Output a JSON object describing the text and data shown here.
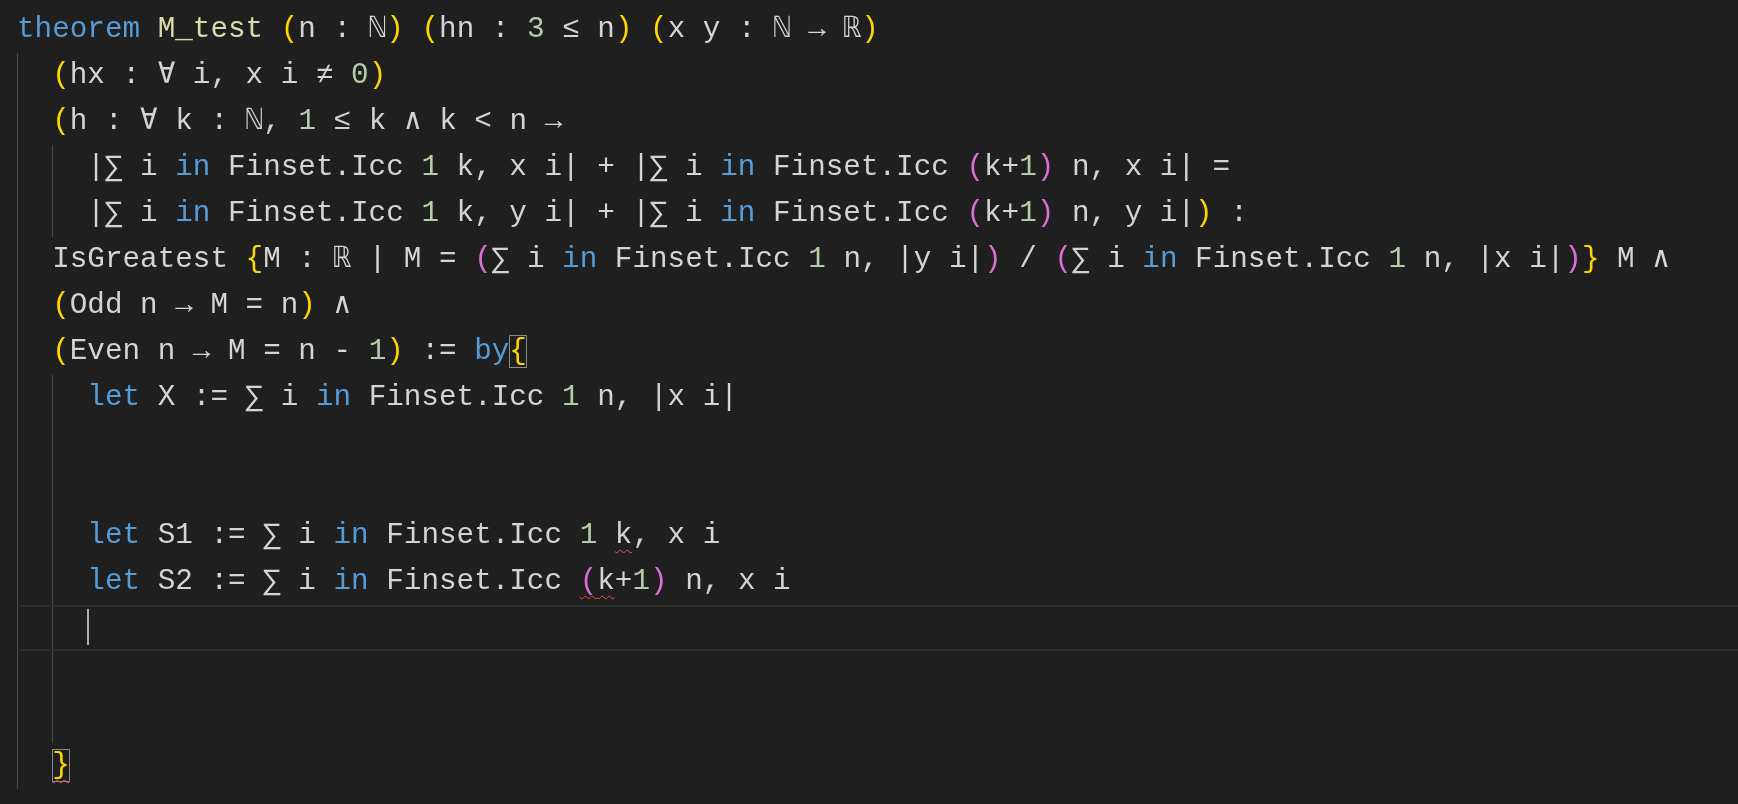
{
  "editor": {
    "lines": [
      {
        "kind": "code",
        "tokens": [
          {
            "text": "theorem",
            "kind": "keyword"
          },
          {
            "text": " M_test ",
            "kind": "decl"
          },
          {
            "text": "(",
            "kind": "paren1"
          },
          {
            "text": "n : ℕ",
            "kind": "plain"
          },
          {
            "text": ")",
            "kind": "paren1"
          },
          {
            "text": " (",
            "kind": "paren1"
          },
          {
            "text": "hn : ",
            "kind": "plain"
          },
          {
            "text": "3",
            "kind": "number"
          },
          {
            "text": " ≤ n",
            "kind": "plain"
          },
          {
            "text": ")",
            "kind": "paren1"
          },
          {
            "text": " (",
            "kind": "paren1"
          },
          {
            "text": "x y : ℕ → ℝ",
            "kind": "plain"
          },
          {
            "text": ")",
            "kind": "paren1"
          }
        ],
        "children": [
          {
            "kind": "code",
            "tokens": [
              {
                "text": "(",
                "kind": "paren1"
              },
              {
                "text": "hx : ∀ i, x i ≠ ",
                "kind": "plain"
              },
              {
                "text": "0",
                "kind": "number"
              },
              {
                "text": ")",
                "kind": "paren1"
              }
            ]
          },
          {
            "kind": "code",
            "tokens": [
              {
                "text": "(",
                "kind": "paren1"
              },
              {
                "text": "h : ∀ k : ℕ, ",
                "kind": "plain"
              },
              {
                "text": "1",
                "kind": "number"
              },
              {
                "text": " ≤ k ∧ k < n →",
                "kind": "plain"
              }
            ],
            "children": [
              {
                "kind": "code",
                "tokens": [
                  {
                    "text": "|∑ i ",
                    "kind": "plain"
                  },
                  {
                    "text": "in",
                    "kind": "keyword"
                  },
                  {
                    "text": " Finset.Icc ",
                    "kind": "plain"
                  },
                  {
                    "text": "1",
                    "kind": "number"
                  },
                  {
                    "text": " k, x i| + |∑ i ",
                    "kind": "plain"
                  },
                  {
                    "text": "in",
                    "kind": "keyword"
                  },
                  {
                    "text": " Finset.Icc ",
                    "kind": "plain"
                  },
                  {
                    "text": "(",
                    "kind": "paren2"
                  },
                  {
                    "text": "k+",
                    "kind": "plain"
                  },
                  {
                    "text": "1",
                    "kind": "number"
                  },
                  {
                    "text": ")",
                    "kind": "paren2"
                  },
                  {
                    "text": " n, x i| =",
                    "kind": "plain"
                  }
                ]
              },
              {
                "kind": "code",
                "tokens": [
                  {
                    "text": "|∑ i ",
                    "kind": "plain"
                  },
                  {
                    "text": "in",
                    "kind": "keyword"
                  },
                  {
                    "text": " Finset.Icc ",
                    "kind": "plain"
                  },
                  {
                    "text": "1",
                    "kind": "number"
                  },
                  {
                    "text": " k, y i| + |∑ i ",
                    "kind": "plain"
                  },
                  {
                    "text": "in",
                    "kind": "keyword"
                  },
                  {
                    "text": " Finset.Icc ",
                    "kind": "plain"
                  },
                  {
                    "text": "(",
                    "kind": "paren2"
                  },
                  {
                    "text": "k+",
                    "kind": "plain"
                  },
                  {
                    "text": "1",
                    "kind": "number"
                  },
                  {
                    "text": ")",
                    "kind": "paren2"
                  },
                  {
                    "text": " n, y i|",
                    "kind": "plain"
                  },
                  {
                    "text": ")",
                    "kind": "paren1"
                  },
                  {
                    "text": " :",
                    "kind": "plain"
                  }
                ]
              }
            ]
          },
          {
            "kind": "code",
            "tokens": [
              {
                "text": "IsGreatest ",
                "kind": "plain"
              },
              {
                "text": "{",
                "kind": "paren1"
              },
              {
                "text": "M : ℝ | M = ",
                "kind": "plain"
              },
              {
                "text": "(",
                "kind": "paren2"
              },
              {
                "text": "∑ i ",
                "kind": "plain"
              },
              {
                "text": "in",
                "kind": "keyword"
              },
              {
                "text": " Finset.Icc ",
                "kind": "plain"
              },
              {
                "text": "1",
                "kind": "number"
              },
              {
                "text": " n, |y i|",
                "kind": "plain"
              },
              {
                "text": ")",
                "kind": "paren2"
              },
              {
                "text": " / ",
                "kind": "plain"
              },
              {
                "text": "(",
                "kind": "paren2"
              },
              {
                "text": "∑ i ",
                "kind": "plain"
              },
              {
                "text": "in",
                "kind": "keyword"
              },
              {
                "text": " Finset.Icc ",
                "kind": "plain"
              },
              {
                "text": "1",
                "kind": "number"
              },
              {
                "text": " n, |x i|",
                "kind": "plain"
              },
              {
                "text": ")",
                "kind": "paren2"
              },
              {
                "text": "}",
                "kind": "paren1"
              },
              {
                "text": " M ∧",
                "kind": "plain"
              }
            ]
          },
          {
            "kind": "code",
            "tokens": [
              {
                "text": "(",
                "kind": "paren1"
              },
              {
                "text": "Odd n → M = n",
                "kind": "plain"
              },
              {
                "text": ")",
                "kind": "paren1"
              },
              {
                "text": " ∧",
                "kind": "plain"
              }
            ]
          },
          {
            "kind": "code",
            "tokens": [
              {
                "text": "(",
                "kind": "paren1"
              },
              {
                "text": "Even n → M = n - ",
                "kind": "plain"
              },
              {
                "text": "1",
                "kind": "number"
              },
              {
                "text": ")",
                "kind": "paren1"
              },
              {
                "text": " := ",
                "kind": "plain"
              },
              {
                "text": "by",
                "kind": "keyword"
              },
              {
                "text": "{",
                "kind": "paren1",
                "matched": true
              }
            ],
            "children": [
              {
                "kind": "code",
                "tokens": [
                  {
                    "text": "let",
                    "kind": "keyword"
                  },
                  {
                    "text": " X := ∑ i ",
                    "kind": "plain"
                  },
                  {
                    "text": "in",
                    "kind": "keyword"
                  },
                  {
                    "text": " Finset.Icc ",
                    "kind": "plain"
                  },
                  {
                    "text": "1",
                    "kind": "number"
                  },
                  {
                    "text": " n, |x i|",
                    "kind": "plain"
                  }
                ]
              },
              {
                "kind": "blank"
              },
              {
                "kind": "blank"
              },
              {
                "kind": "code",
                "tokens": [
                  {
                    "text": "let",
                    "kind": "keyword"
                  },
                  {
                    "text": " S1 := ∑ i ",
                    "kind": "plain"
                  },
                  {
                    "text": "in",
                    "kind": "keyword"
                  },
                  {
                    "text": " Finset.Icc ",
                    "kind": "plain"
                  },
                  {
                    "text": "1 ",
                    "kind": "number"
                  },
                  {
                    "text": "k",
                    "kind": "plain",
                    "error": true
                  },
                  {
                    "text": ", x i",
                    "kind": "plain"
                  }
                ]
              },
              {
                "kind": "code",
                "tokens": [
                  {
                    "text": "let",
                    "kind": "keyword"
                  },
                  {
                    "text": " S2 := ∑ i ",
                    "kind": "plain"
                  },
                  {
                    "text": "in",
                    "kind": "keyword"
                  },
                  {
                    "text": " Finset.Icc ",
                    "kind": "plain"
                  },
                  {
                    "text": "(",
                    "kind": "paren2",
                    "error": true
                  },
                  {
                    "text": "k",
                    "kind": "plain",
                    "error": true
                  },
                  {
                    "text": "+",
                    "kind": "plain"
                  },
                  {
                    "text": "1",
                    "kind": "number"
                  },
                  {
                    "text": ")",
                    "kind": "paren2"
                  },
                  {
                    "text": " n, x i",
                    "kind": "plain"
                  }
                ]
              },
              {
                "kind": "cursor"
              },
              {
                "kind": "blank"
              },
              {
                "kind": "blank"
              }
            ]
          },
          {
            "kind": "code",
            "tokens": [
              {
                "text": "}",
                "kind": "paren1",
                "matched": true,
                "error": true
              }
            ]
          }
        ]
      }
    ]
  }
}
